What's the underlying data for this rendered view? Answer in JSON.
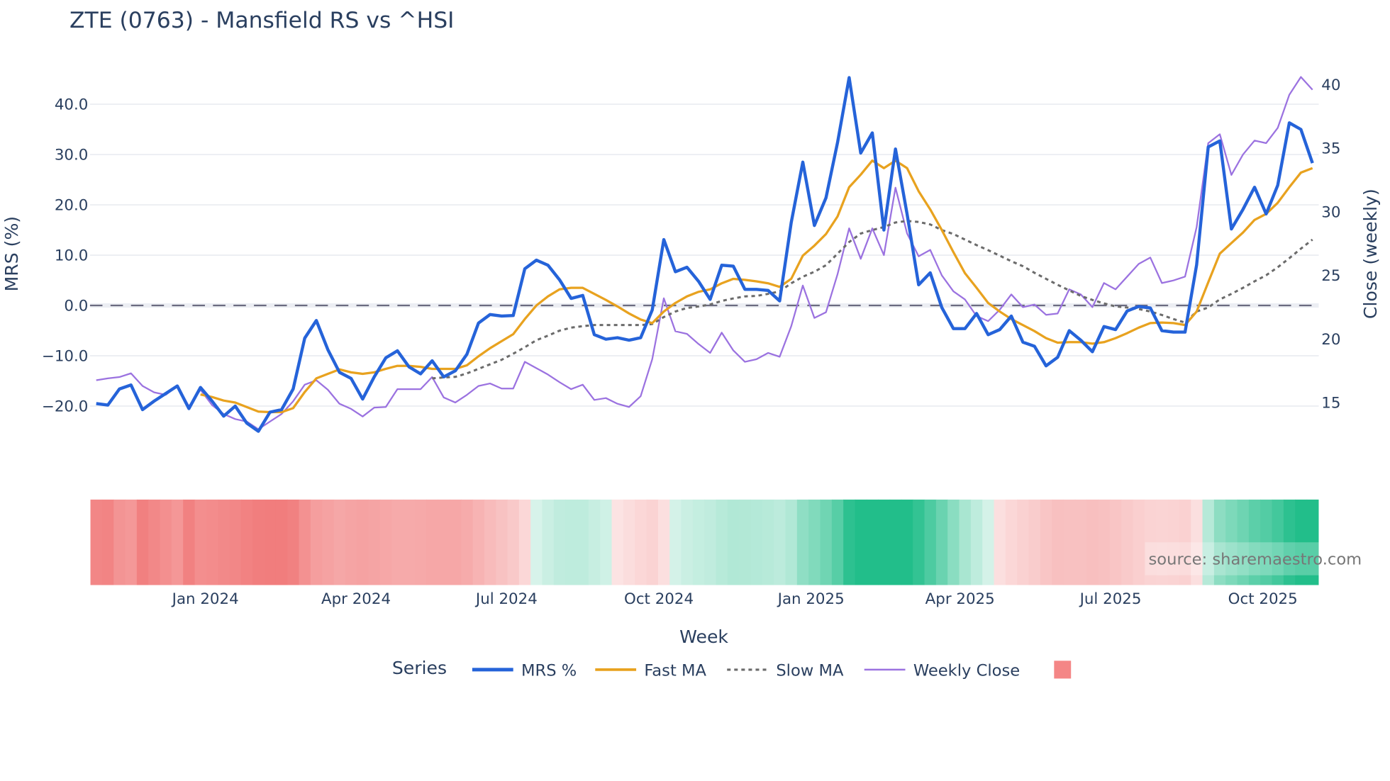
{
  "chart_data": {
    "type": "line",
    "title": "ZTE (0763) - Mansfield RS vs ^HSI",
    "xlabel": "Week",
    "ylabel": "MRS (%)",
    "y2label": "Close (weekly)",
    "source": "source: sharemaestro.com",
    "start_week": "2023-10-27",
    "interval_days": 7,
    "ylim": [
      -27,
      47
    ],
    "y2lim": [
      11.5,
      41.5
    ],
    "yticks": [
      -20,
      -10,
      0,
      10,
      20,
      30,
      40
    ],
    "ytick_labels": [
      "−20.0",
      "−10.0",
      "0.0",
      "10.0",
      "20.0",
      "30.0",
      "40.0"
    ],
    "y2ticks": [
      15,
      20,
      25,
      30,
      35,
      40
    ],
    "y2tick_labels": [
      "15",
      "20",
      "25",
      "30",
      "35",
      "40"
    ],
    "xticks": [
      {
        "date": "2024-01-01",
        "label": "Jan 2024"
      },
      {
        "date": "2024-04-01",
        "label": "Apr 2024"
      },
      {
        "date": "2024-07-01",
        "label": "Jul 2024"
      },
      {
        "date": "2024-10-01",
        "label": "Oct 2024"
      },
      {
        "date": "2025-01-01",
        "label": "Jan 2025"
      },
      {
        "date": "2025-04-01",
        "label": "Apr 2025"
      },
      {
        "date": "2025-07-01",
        "label": "Jul 2025"
      },
      {
        "date": "2025-10-01",
        "label": "Oct 2025"
      }
    ],
    "zero_line": 0,
    "grid": true,
    "legend": {
      "title": "Series",
      "placement": "bottom-center"
    },
    "series": [
      {
        "name": "MRS %",
        "axis": "left",
        "color": "#2563d9",
        "style": "solid",
        "start_index": 0,
        "values": [
          -19.5,
          -19.8,
          -16.6,
          -15.8,
          -20.7,
          -19,
          -17.5,
          -16,
          -20.5,
          -16.3,
          -19,
          -22,
          -20,
          -23.4,
          -25,
          -21.2,
          -20.7,
          -16.6,
          -6.5,
          -3,
          -8.8,
          -13.3,
          -14.5,
          -18.6,
          -14.2,
          -10.4,
          -9,
          -12.2,
          -13.6,
          -11,
          -14.2,
          -13,
          -9.7,
          -3.5,
          -1.8,
          -2.1,
          -2,
          7.3,
          9,
          8,
          5.1,
          1.4,
          2,
          -5.8,
          -6.7,
          -6.4,
          -6.9,
          -6.4,
          -0.9,
          13.1,
          6.7,
          7.6,
          4.8,
          1.2,
          8,
          7.8,
          3.2,
          3.2,
          3,
          0.9,
          16.5,
          28.5,
          15.9,
          21.4,
          32.4,
          45.3,
          30.3,
          34.3,
          15,
          31.1,
          18.2,
          4.1,
          6.5,
          -0.4,
          -4.6,
          -4.6,
          -1.6,
          -5.8,
          -4.8,
          -2.1,
          -7.3,
          -8.1,
          -12,
          -10.3,
          -5,
          -6.9,
          -9.2,
          -4.2,
          -4.8,
          -1.1,
          -0.2,
          -0.5,
          -5,
          -5.3,
          -5.3,
          8.1,
          31.5,
          32.7,
          15.2,
          19.1,
          23.5,
          18.2,
          23.9,
          36.3,
          35,
          28.3
        ]
      },
      {
        "name": "Fast MA",
        "axis": "left",
        "color": "#e8a21f",
        "style": "solid",
        "start_index": 9,
        "values": [
          -17.7,
          -18.2,
          -18.9,
          -19.3,
          -20.2,
          -21.1,
          -21.2,
          -21.2,
          -20.4,
          -17.2,
          -14.5,
          -13.6,
          -12.7,
          -13.3,
          -13.6,
          -13.3,
          -12.6,
          -12.0,
          -12.0,
          -12.2,
          -12.6,
          -12.6,
          -12.6,
          -11.9,
          -10.1,
          -8.5,
          -7.1,
          -5.7,
          -2.7,
          0,
          1.8,
          3.2,
          3.5,
          3.5,
          2.3,
          1.1,
          -0.2,
          -1.6,
          -2.8,
          -3.5,
          -1.2,
          0.5,
          1.8,
          2.7,
          3.2,
          4.4,
          5.3,
          5.1,
          4.8,
          4.4,
          3.7,
          5.3,
          9.9,
          11.9,
          14.2,
          17.7,
          23.5,
          26.0,
          28.8,
          27.3,
          28.8,
          27.3,
          22.7,
          19.1,
          15.0,
          10.6,
          6.4,
          3.5,
          0.5,
          -1.2,
          -2.7,
          -3.9,
          -5.1,
          -6.5,
          -7.4,
          -7.3,
          -7.3,
          -7.6,
          -7.3,
          -6.5,
          -5.5,
          -4.4,
          -3.5,
          -3.4,
          -3.5,
          -3.9,
          -1.2,
          4.6,
          10.3,
          12.4,
          14.5,
          17.0,
          18.2,
          20.4,
          23.5,
          26.4,
          27.3
        ]
      },
      {
        "name": "Slow MA",
        "axis": "left",
        "color": "#6b6b6b",
        "style": "dotted",
        "start_index": 29,
        "values": [
          -14.5,
          -14.3,
          -14.2,
          -13.5,
          -12.6,
          -11.7,
          -10.8,
          -9.6,
          -8.3,
          -6.9,
          -6.0,
          -5.0,
          -4.4,
          -4.1,
          -3.9,
          -3.9,
          -3.9,
          -3.9,
          -3.9,
          -3.7,
          -2.3,
          -1.2,
          -0.5,
          -0.2,
          0.2,
          0.9,
          1.4,
          1.8,
          1.9,
          2.3,
          2.8,
          4.4,
          5.7,
          6.7,
          8.0,
          10.3,
          12.6,
          14.3,
          15.0,
          15.6,
          16.5,
          16.8,
          16.6,
          16.1,
          15.0,
          14.2,
          13.1,
          12.0,
          11.0,
          9.9,
          8.8,
          7.8,
          6.5,
          5.3,
          4.1,
          3.0,
          1.9,
          1.1,
          0.4,
          -0.2,
          -0.4,
          -0.7,
          -1.2,
          -1.9,
          -2.7,
          -3.4,
          -1.2,
          -0.4,
          1.2,
          2.3,
          3.5,
          4.8,
          6.0,
          7.6,
          9.4,
          11.3,
          13.1
        ]
      },
      {
        "name": "Weekly Close",
        "axis": "right",
        "color": "#9b72e0",
        "style": "solid",
        "start_index": 0,
        "values": [
          16.75,
          16.9,
          17.0,
          17.3,
          16.3,
          15.8,
          15.6,
          16.3,
          14.7,
          16.0,
          14.8,
          14.1,
          13.7,
          13.5,
          12.9,
          13.5,
          14.1,
          15.1,
          16.4,
          16.75,
          16.0,
          14.9,
          14.5,
          13.9,
          14.6,
          14.65,
          16.05,
          16.05,
          16.05,
          17.0,
          15.4,
          15.0,
          15.6,
          16.3,
          16.5,
          16.1,
          16.1,
          18.2,
          17.7,
          17.2,
          16.6,
          16.05,
          16.4,
          15.2,
          15.35,
          14.9,
          14.65,
          15.5,
          18.4,
          23.2,
          20.6,
          20.4,
          19.6,
          18.9,
          20.5,
          19.1,
          18.2,
          18.4,
          18.9,
          18.6,
          21.0,
          24.2,
          21.65,
          22.1,
          25.1,
          28.7,
          26.3,
          28.7,
          26.6,
          31.9,
          28.3,
          26.5,
          27.0,
          25.0,
          23.75,
          23.1,
          21.8,
          21.4,
          22.3,
          23.5,
          22.5,
          22.7,
          21.9,
          22.0,
          23.9,
          23.5,
          22.5,
          24.4,
          23.9,
          24.9,
          25.9,
          26.4,
          24.4,
          24.6,
          24.9,
          28.8,
          35.4,
          36.1,
          32.9,
          34.5,
          35.6,
          35.4,
          36.6,
          39.2,
          40.6,
          39.6
        ]
      }
    ],
    "heatmap": {
      "source_series": "Fast MA",
      "fallback_series": "MRS %",
      "neg_color": "#ef6b6b",
      "pos_color": "#22be8a",
      "clamp": 25,
      "legend_swatch_color": "#f48686"
    }
  }
}
